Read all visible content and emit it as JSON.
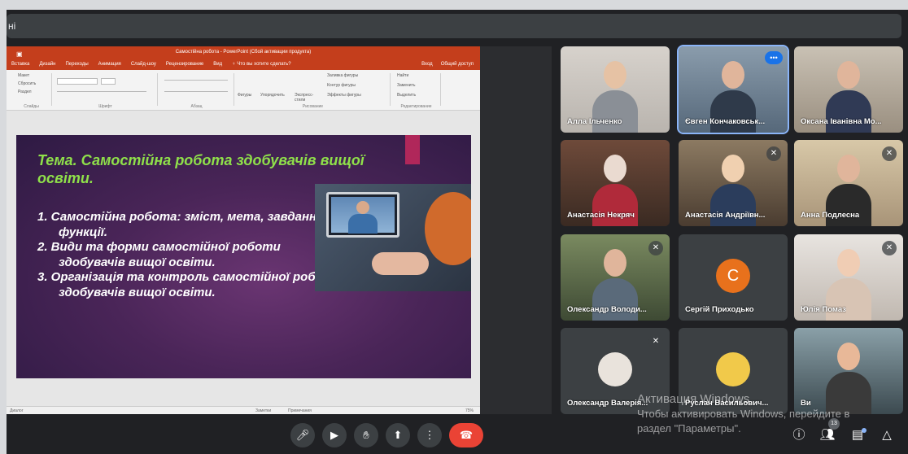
{
  "window": {
    "title_fragment": "ні"
  },
  "powerpoint": {
    "title": "Самостійна робота - PowerPoint (Сбой активации продукта)",
    "tabs": [
      "Вставка",
      "Дизайн",
      "Переходы",
      "Анимация",
      "Слайд-шоу",
      "Рецензирование",
      "Вид",
      "♀ Что вы хотите сделать?"
    ],
    "tabs_right": [
      "Вход",
      "Общий доступ"
    ],
    "ribbon": {
      "slides_items": [
        "Макет",
        "Сбросить",
        "Раздел"
      ],
      "group_labels": [
        "Слайды",
        "Шрифт",
        "Абзац",
        "Рисование",
        "Редактирование"
      ],
      "drawing_buttons": [
        "Фигуры",
        "Упорядочить",
        "Экспресс-стили"
      ],
      "drawing_options": [
        "Заливка фигуры",
        "Контур фигуры",
        "Эффекты фигуры"
      ],
      "edit_options": [
        "Найти",
        "Заменить",
        "Выделить"
      ]
    },
    "slide": {
      "title": "Тема. Самостійна робота здобувачів вищої освіти.",
      "items": [
        "1.  Самостійна робота: зміст, мета, завдання, функції.",
        "2.  Види та форми самостійної роботи здобувачів вищої освіти.",
        "3.  Організація та контроль самостійної роботи здобувачів вищої освіти."
      ]
    },
    "status": {
      "left": "Диалог",
      "notes": "Заметки",
      "comments": "Примечания",
      "zoom": "75%"
    }
  },
  "participants": [
    {
      "name": "Алла Ільченко",
      "muted": false
    },
    {
      "name": "Євген Кончаковськ...",
      "muted": false,
      "speaking": true
    },
    {
      "name": "Оксана Іванівна Мо...",
      "muted": false
    },
    {
      "name": "Анастасія Некряч",
      "muted": false
    },
    {
      "name": "Анастасія Андріївн...",
      "muted": true
    },
    {
      "name": "Анна Подлесна",
      "muted": true
    },
    {
      "name": "Олександр Володи...",
      "muted": true
    },
    {
      "name": "Сергій Приходько",
      "muted": false,
      "initial": "С"
    },
    {
      "name": "Юлія Помаз",
      "muted": true
    },
    {
      "name": "Олександр Валерія...",
      "muted": true
    },
    {
      "name": "Руслан Васильович...",
      "muted": false
    },
    {
      "name": "Ви",
      "muted": false
    }
  ],
  "watermark": {
    "line1": "Активация Windows",
    "line2": "Чтобы активировать Windows, перейдите в",
    "line3": "раздел \"Параметры\"."
  },
  "controls": {
    "participants_count": "13"
  },
  "colors": {
    "end_call": "#ea4335",
    "meet_bg": "#202124",
    "ppt_accent": "#c43e1c",
    "slide_title": "#8fe04a"
  }
}
